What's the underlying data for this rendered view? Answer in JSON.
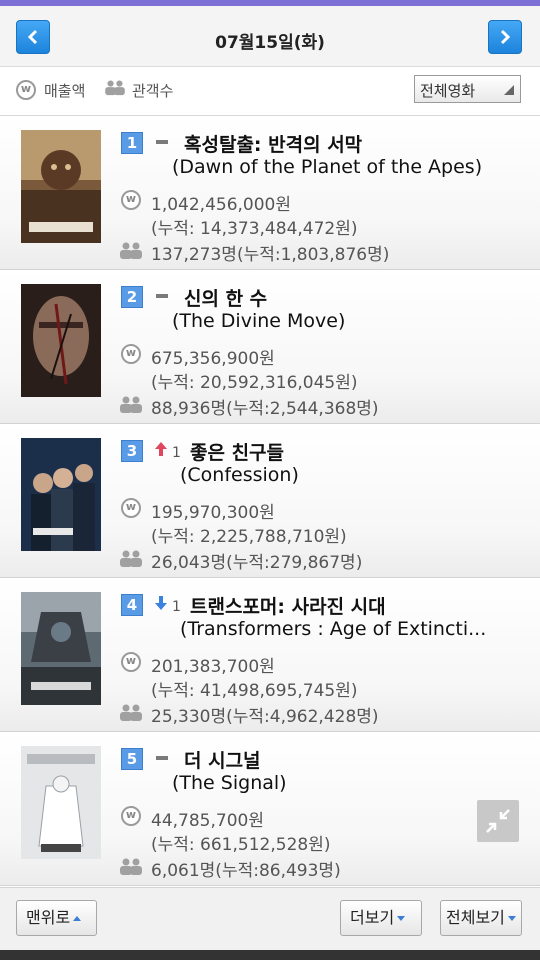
{
  "header": {
    "date": "07월15일(화)"
  },
  "legend": {
    "sales_label": "매출액",
    "audience_label": "관객수"
  },
  "filter": {
    "selected": "전체영화"
  },
  "colors": {
    "accent": "#2f93ea",
    "rank_badge": "#5a9be6",
    "up": "#e0475f",
    "down": "#3a82e0"
  },
  "movies": [
    {
      "rank": "1",
      "change_type": "none",
      "change_value": "",
      "title_ko": "혹성탈출: 반격의 서막",
      "title_en": "(Dawn of the Planet of the Apes)",
      "sales": "1,042,456,000원",
      "sales_acc": "(누적: 14,373,484,472원)",
      "audience": "137,273명(누적:1,803,876명)"
    },
    {
      "rank": "2",
      "change_type": "none",
      "change_value": "",
      "title_ko": "신의 한 수",
      "title_en": "(The Divine Move)",
      "sales": "675,356,900원",
      "sales_acc": "(누적: 20,592,316,045원)",
      "audience": "88,936명(누적:2,544,368명)"
    },
    {
      "rank": "3",
      "change_type": "up",
      "change_value": "1",
      "title_ko": "좋은 친구들",
      "title_en": "(Confession)",
      "sales": "195,970,300원",
      "sales_acc": "(누적: 2,225,788,710원)",
      "audience": "26,043명(누적:279,867명)"
    },
    {
      "rank": "4",
      "change_type": "down",
      "change_value": "1",
      "title_ko": "트랜스포머: 사라진 시대",
      "title_en": "(Transformers : Age of Extincti...",
      "sales": "201,383,700원",
      "sales_acc": "(누적: 41,498,695,745원)",
      "audience": "25,330명(누적:4,962,428명)"
    },
    {
      "rank": "5",
      "change_type": "none",
      "change_value": "",
      "title_ko": "더 시그널",
      "title_en": "(The Signal)",
      "sales": "44,785,700원",
      "sales_acc": "(누적: 661,512,528원)",
      "audience": "6,061명(누적:86,493명)"
    }
  ],
  "footer": {
    "top_label": "맨위로",
    "more_label": "더보기",
    "all_label": "전체보기"
  }
}
